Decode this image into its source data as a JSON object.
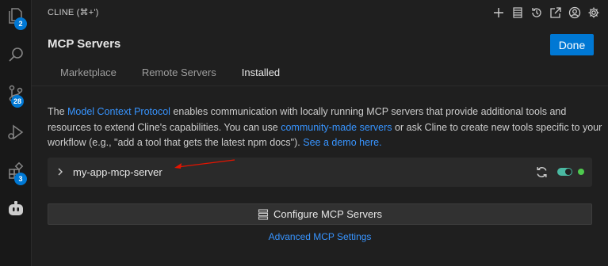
{
  "activity_bar": {
    "items": [
      {
        "icon": "files-icon",
        "badge": "2"
      },
      {
        "icon": "search-icon",
        "badge": ""
      },
      {
        "icon": "source-control-icon",
        "badge": "28"
      },
      {
        "icon": "run-debug-icon",
        "badge": ""
      },
      {
        "icon": "extensions-icon",
        "badge": "3"
      },
      {
        "icon": "cline-robot-icon",
        "badge": ""
      }
    ]
  },
  "panel": {
    "title": "CLINE (⌘+')",
    "actions": [
      "plus-icon",
      "history-list-icon",
      "history-icon",
      "popout-icon",
      "account-icon",
      "settings-gear-icon"
    ]
  },
  "header": {
    "title": "MCP Servers",
    "done_label": "Done"
  },
  "tabs": [
    {
      "label": "Marketplace",
      "active": false
    },
    {
      "label": "Remote Servers",
      "active": false
    },
    {
      "label": "Installed",
      "active": true
    }
  ],
  "description": {
    "t1": "The ",
    "link1": "Model Context Protocol",
    "t2": " enables communication with locally running MCP servers that provide additional tools and resources to extend Cline's capabilities. You can use ",
    "link2": "community-made servers",
    "t3": " or ask Cline to create new tools specific to your workflow (e.g., \"add a tool that gets the latest npm docs\"). ",
    "link3": "See a demo here."
  },
  "server": {
    "name": "my-app-mcp-server",
    "enabled": true,
    "status": "connected"
  },
  "configure_label": "Configure MCP Servers",
  "advanced_label": "Advanced MCP Settings",
  "colors": {
    "accent": "#0078d4",
    "link": "#3794ff",
    "status_green": "#4ec94e",
    "annotation_red": "#e51400"
  }
}
